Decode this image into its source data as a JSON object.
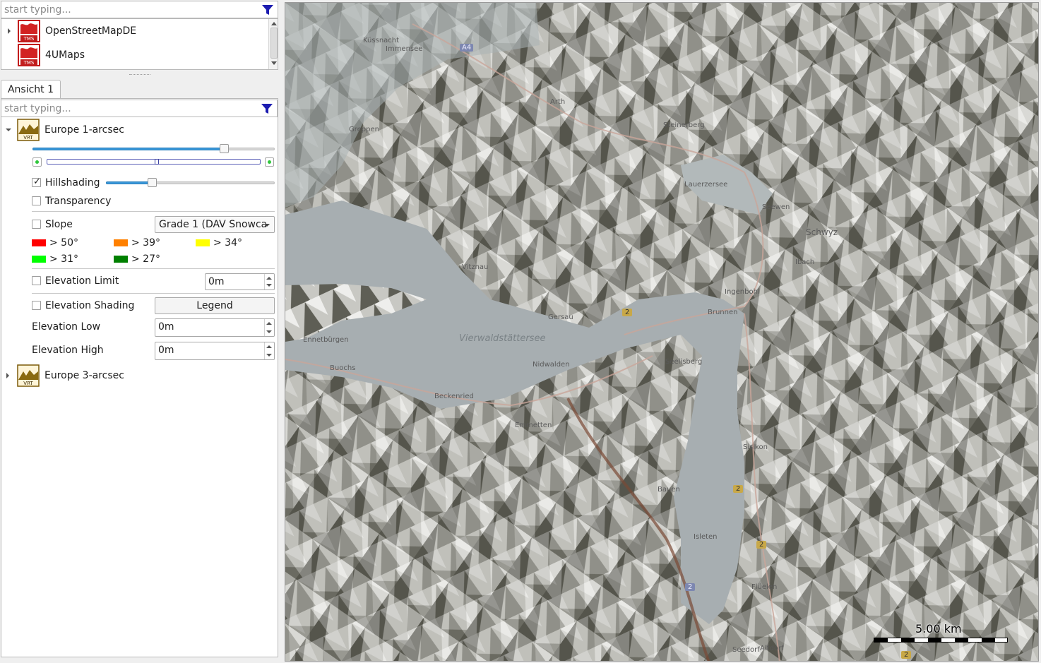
{
  "layer_search": {
    "placeholder": "start typing..."
  },
  "map_layers": [
    {
      "label": "OpenStreetMapDE",
      "icon": "tms-map-icon",
      "badge": "TMS"
    },
    {
      "label": "4UMaps",
      "icon": "tms-map-icon",
      "badge": "TMS"
    }
  ],
  "view_tab": {
    "label": "Ansicht 1"
  },
  "dem_search": {
    "placeholder": "start typing..."
  },
  "dem_layers": [
    {
      "label": "Europe 1-arcsec",
      "badge": "VRT",
      "expanded": true
    },
    {
      "label": "Europe 3-arcsec",
      "badge": "VRT",
      "expanded": false
    }
  ],
  "dem_settings": {
    "opacity_level": 0.79,
    "range_mid": 0.51,
    "hillshading": {
      "label": "Hillshading",
      "checked": true,
      "level": 0.27
    },
    "transparency": {
      "label": "Transparency",
      "checked": false
    },
    "slope": {
      "label": "Slope",
      "checked": false,
      "grade": "Grade 1 (DAV Snowca"
    },
    "slope_legend": [
      {
        "label": "> 50°",
        "color": "#ff0000"
      },
      {
        "label": "> 39°",
        "color": "#ff8000"
      },
      {
        "label": "> 34°",
        "color": "#ffff00"
      },
      {
        "label": "> 31°",
        "color": "#00ff00"
      },
      {
        "label": "> 27°",
        "color": "#008000"
      }
    ],
    "elevation_limit": {
      "label": "Elevation Limit",
      "checked": false,
      "value": "0m"
    },
    "elevation_shading": {
      "label": "Elevation Shading",
      "checked": false,
      "legend_button": "Legend"
    },
    "elevation_low": {
      "label": "Elevation Low",
      "value": "0m"
    },
    "elevation_high": {
      "label": "Elevation High",
      "value": "0m"
    }
  },
  "map": {
    "scale_label": "5.00 km",
    "places": [
      "Arth",
      "Steinerberg",
      "Lauerzersee",
      "Seewen",
      "Schwyz",
      "Ibach",
      "Ingenbohl",
      "Brunnen",
      "Gersau",
      "Vitznau",
      "Vierwaldstättersee",
      "Nidwalden",
      "Seelisberg",
      "Beckenried",
      "Emmetten",
      "Ennetbürgen",
      "Buochs",
      "Sisikon",
      "Flüelen",
      "Altdorf",
      "Seedorf",
      "Bauen",
      "Isleten",
      "Immensee",
      "Küssnacht",
      "Greppen"
    ],
    "road_shields": [
      "A4",
      "2",
      "2",
      "2",
      "2",
      "2"
    ]
  }
}
